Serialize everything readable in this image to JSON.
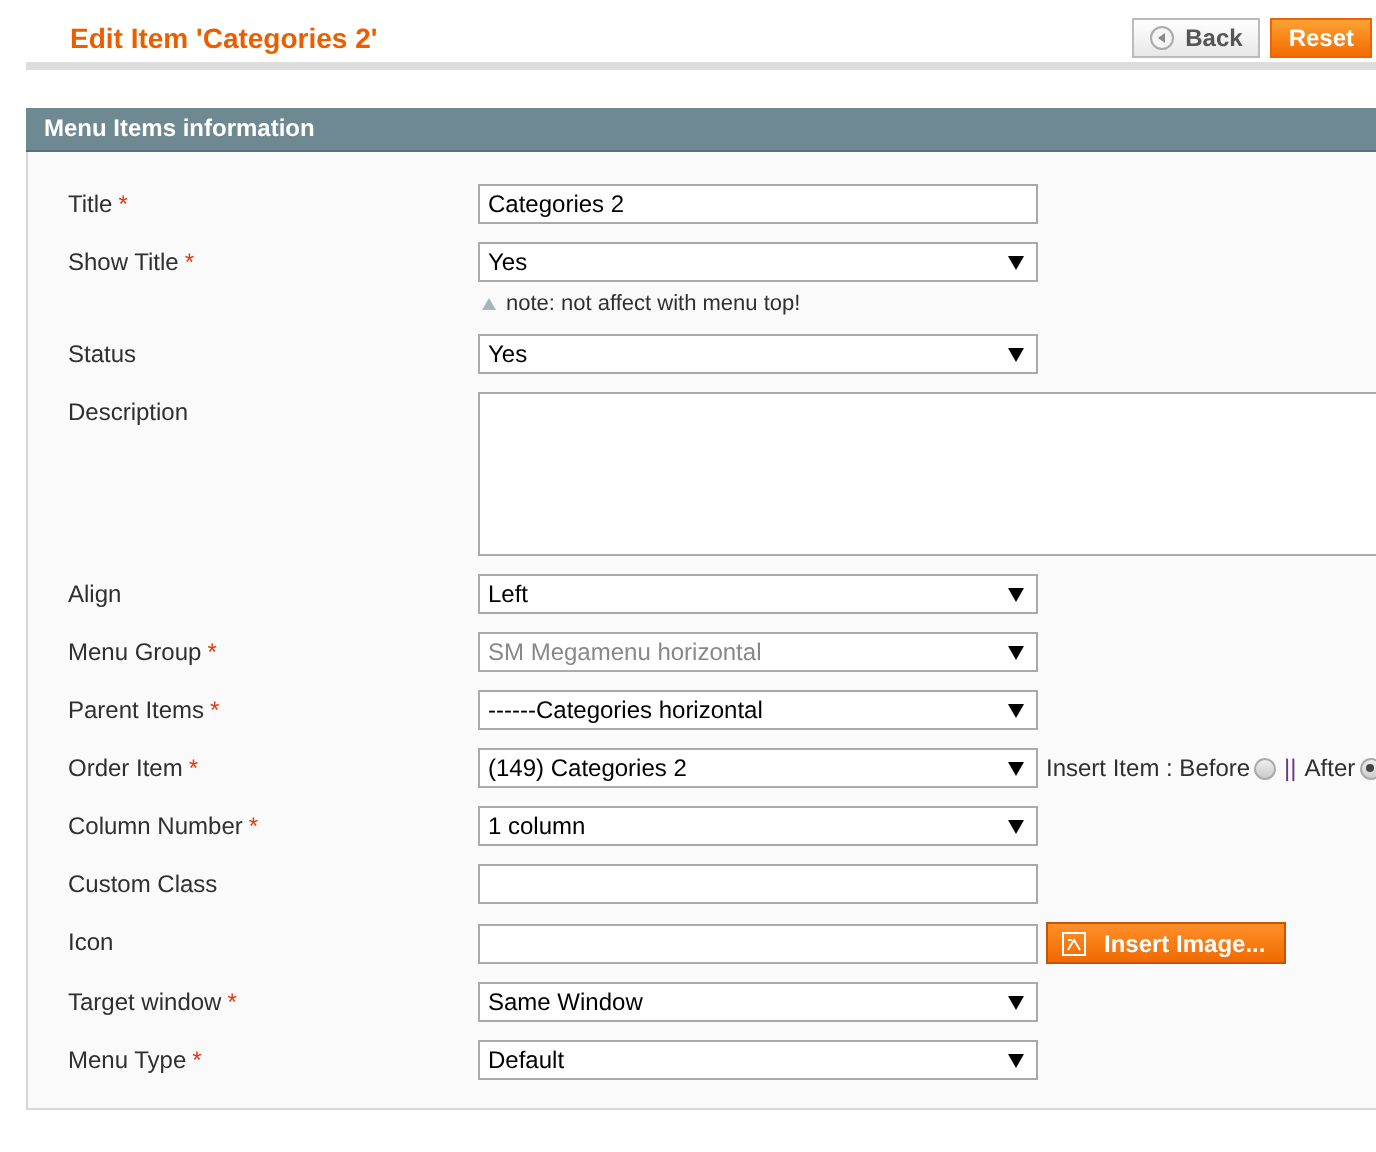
{
  "page_title": "Edit Item 'Categories 2'",
  "buttons": [
    {
      "label": "Back",
      "kind": "back"
    },
    {
      "label": "Reset",
      "kind": "primary"
    }
  ],
  "section": {
    "title": "Menu Items information"
  },
  "required_symbol": "*",
  "fields": [
    {
      "label": "Title",
      "required": true,
      "kind": "text",
      "value": "Categories 2"
    },
    {
      "label": "Show Title",
      "required": true,
      "kind": "select",
      "value": "Yes",
      "note": "note: not affect with menu top!"
    },
    {
      "label": "Status",
      "required": false,
      "kind": "select",
      "value": "Yes"
    },
    {
      "label": "Description",
      "required": false,
      "kind": "textarea"
    },
    {
      "label": "Align",
      "required": false,
      "kind": "select",
      "value": "Left"
    },
    {
      "label": "Menu Group",
      "required": true,
      "kind": "select",
      "value": "SM Megamenu horizontal",
      "disabled": true
    },
    {
      "label": "Parent Items",
      "required": true,
      "kind": "select",
      "value": "------Categories horizontal"
    },
    {
      "label": "Order Item",
      "required": true,
      "kind": "select",
      "value": "(149) Categories 2",
      "radios": {
        "separator": "||",
        "options": [
          {
            "label": "Insert Item : Before",
            "selected": false
          },
          {
            "label": "After",
            "selected": true
          }
        ]
      }
    },
    {
      "label": "Column Number",
      "required": true,
      "kind": "select",
      "value": "1 column"
    },
    {
      "label": "Custom Class",
      "required": false,
      "kind": "text"
    },
    {
      "label": "Icon",
      "required": false,
      "kind": "text",
      "button": "Insert Image..."
    },
    {
      "label": "Target window",
      "required": true,
      "kind": "select",
      "value": "Same Window"
    },
    {
      "label": "Menu Type",
      "required": true,
      "kind": "select",
      "value": "Default"
    }
  ]
}
